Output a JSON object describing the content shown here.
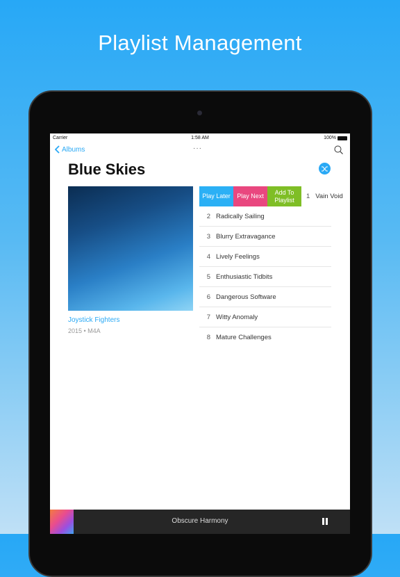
{
  "headline": "Playlist Management",
  "status": {
    "carrier": "Carrier",
    "time": "1:58 AM",
    "battery": "100%"
  },
  "nav": {
    "back_label": "Albums",
    "more": "···"
  },
  "album": {
    "title": "Blue Skies",
    "artist": "Joystick Fighters",
    "meta": "2015 • M4A"
  },
  "swipe_actions": [
    {
      "label": "Play Later",
      "color": "#2bb0f5"
    },
    {
      "label": "Play Next",
      "color": "#e9477f"
    },
    {
      "label": "Add To Playlist",
      "color": "#7fbe26"
    }
  ],
  "tracks": [
    {
      "num": "1",
      "title": "Vain Void"
    },
    {
      "num": "2",
      "title": "Radically Sailing"
    },
    {
      "num": "3",
      "title": "Blurry Extravagance"
    },
    {
      "num": "4",
      "title": "Lively Feelings"
    },
    {
      "num": "5",
      "title": "Enthusiastic Tidbits"
    },
    {
      "num": "6",
      "title": "Dangerous Software"
    },
    {
      "num": "7",
      "title": "Witty Anomaly"
    },
    {
      "num": "8",
      "title": "Mature Challenges"
    }
  ],
  "player": {
    "now_playing": "Obscure Harmony"
  },
  "colors": {
    "accent": "#2aa9f5",
    "player_bg": "#262626"
  }
}
